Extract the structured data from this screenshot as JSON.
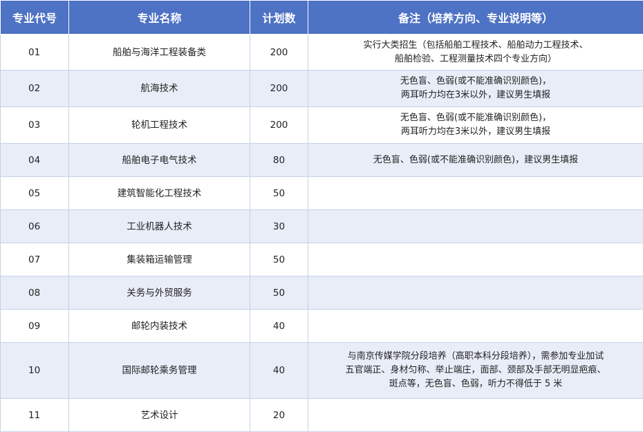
{
  "headers": [
    "专业代号",
    "专业名称",
    "计划数",
    "备注（培养方向、专业说明等）"
  ],
  "rows": [
    {
      "code": "01",
      "name": "船舶与海洋工程装备类",
      "plan": "200",
      "note": [
        "实行大类招生（包括船舶工程技术、船舶动力工程技术、",
        "船舶检验、工程测量技术四个专业方向）"
      ]
    },
    {
      "code": "02",
      "name": "航海技术",
      "plan": "200",
      "note": [
        "无色盲、色弱(或不能准确识别颜色)，",
        "两耳听力均在3米以外，建议男生填报"
      ]
    },
    {
      "code": "03",
      "name": "轮机工程技术",
      "plan": "200",
      "note": [
        "无色盲、色弱(或不能准确识别颜色)，",
        "两耳听力均在3米以外，建议男生填报"
      ]
    },
    {
      "code": "04",
      "name": "船舶电子电气技术",
      "plan": "80",
      "note": [
        "无色盲、色弱(或不能准确识别颜色)，建议男生填报"
      ]
    },
    {
      "code": "05",
      "name": "建筑智能化工程技术",
      "plan": "50",
      "note": []
    },
    {
      "code": "06",
      "name": "工业机器人技术",
      "plan": "30",
      "note": []
    },
    {
      "code": "07",
      "name": "集装箱运输管理",
      "plan": "50",
      "note": []
    },
    {
      "code": "08",
      "name": "关务与外贸服务",
      "plan": "50",
      "note": []
    },
    {
      "code": "09",
      "name": "邮轮内装技术",
      "plan": "40",
      "note": []
    },
    {
      "code": "10",
      "name": "国际邮轮乘务管理",
      "plan": "40",
      "note": [
        "与南京传媒学院分段培养（高职本科分段培养），需参加专业加试",
        "五官端正、身材匀称、举止端庄，面部、颈部及手部无明显疤痕、",
        "斑点等，无色盲、色弱，听力不得低于 5 米"
      ]
    },
    {
      "code": "11",
      "name": "艺术设计",
      "plan": "20",
      "note": []
    }
  ]
}
